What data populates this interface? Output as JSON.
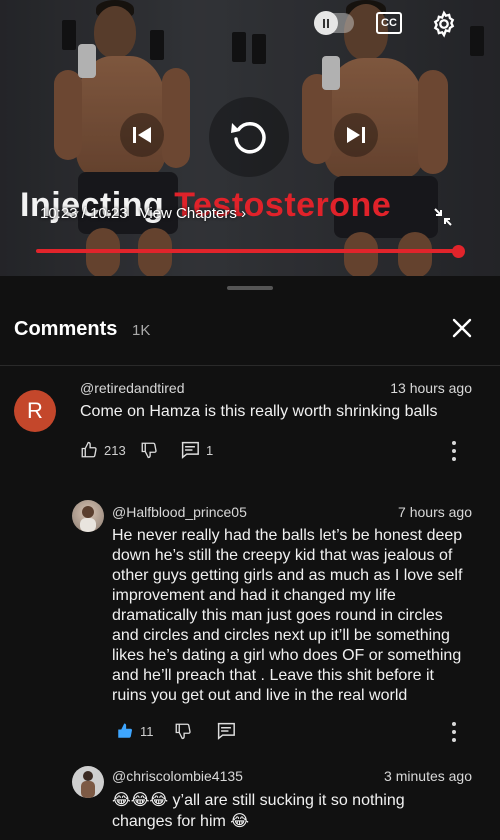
{
  "player": {
    "title_part1": "Injecting",
    "title_part2": "Testosterone",
    "current_time": "10:23",
    "time_separator": "/",
    "duration": "10:23",
    "chapters_label": "View Chapters",
    "cc_label": "CC",
    "progress": 1.0,
    "accent_color": "#e1242b"
  },
  "comments_panel": {
    "title": "Comments",
    "count": "1K"
  },
  "comments": [
    {
      "author": "@retiredandtired",
      "avatar_letter": "R",
      "avatar_color": "#c4472b",
      "time": "13 hours ago",
      "text": "Come on Hamza is this really worth shrinking balls",
      "likes": "213",
      "replies": "1"
    },
    {
      "author": "@Halfblood_prince05",
      "time": "7 hours ago",
      "text": "He never really had the balls let’s be honest deep down he’s still the creepy kid that was jealous of other guys getting girls and as much as I love self improvement and had it changed my life dramatically this man just goes round in circles and circles and circles next up it’ll be something likes he’s dating a girl who does OF or something and he’ll preach that . Leave this shit before it ruins you get out and live in the real world",
      "likes": "11",
      "liked": true,
      "like_color": "#3ea6ff"
    },
    {
      "author": "@chriscolombie4135",
      "time": "3 minutes ago",
      "emoji_prefix": "😂😂😂",
      "text": "y’all are still sucking it so nothing changes for him",
      "emoji_suffix": "😂"
    }
  ]
}
